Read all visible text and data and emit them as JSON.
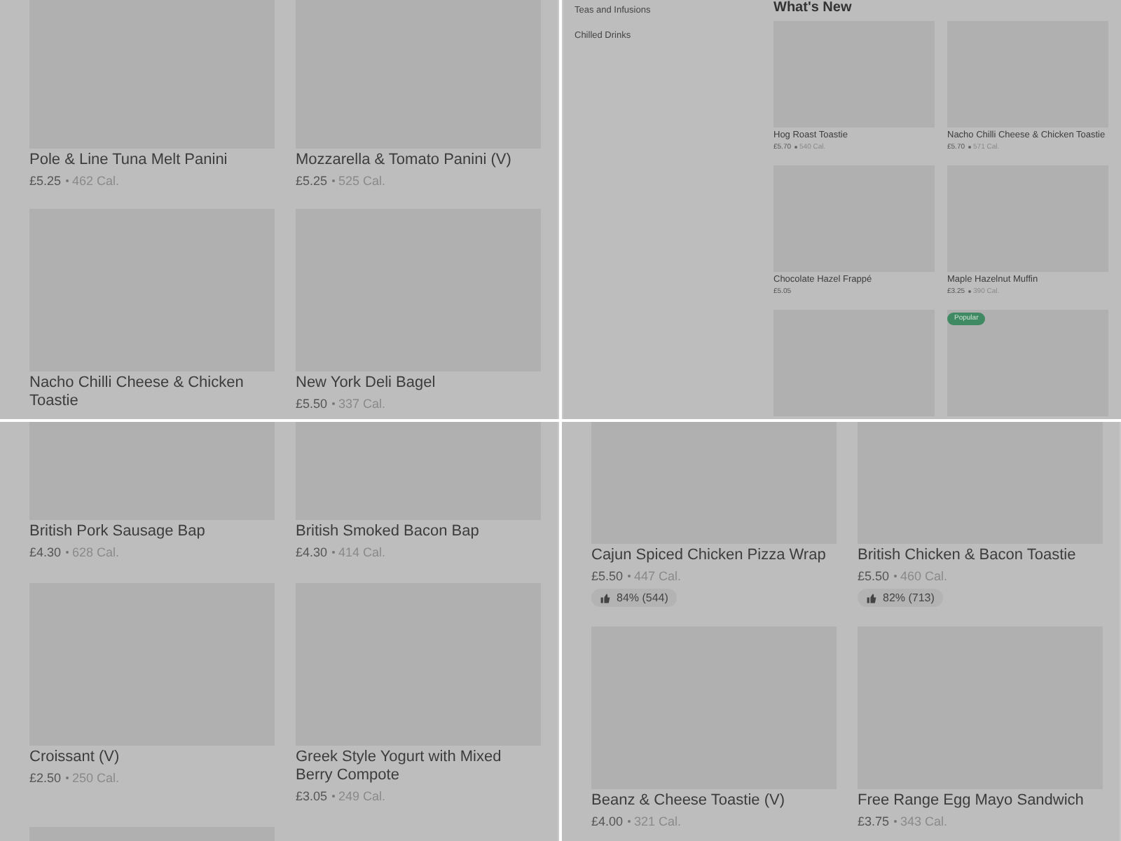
{
  "panels": [
    {
      "kind": "grid",
      "items": [
        {
          "kind": "card",
          "title": "Pole & Line Tuna Melt Panini",
          "price": "£5.25",
          "calories": "462 Cal."
        },
        {
          "kind": "card",
          "title": "Mozzarella & Tomato Panini (V)",
          "price": "£5.25",
          "calories": "525 Cal."
        },
        {
          "kind": "card",
          "title": "Nacho Chilli Cheese & Chicken Toastie"
        },
        {
          "kind": "card",
          "title": "New York Deli Bagel",
          "price": "£5.50",
          "calories": "337 Cal."
        }
      ]
    },
    {
      "kind": "menu",
      "sidebar": {
        "items": [
          {
            "label": "Teas and Infusions"
          },
          {
            "label": "Chilled Drinks"
          }
        ]
      },
      "section_title": "What's New",
      "items": [
        {
          "kind": "card",
          "title": "Hog Roast Toastie",
          "price": "£5.70",
          "calories": "540 Cal."
        },
        {
          "kind": "card",
          "title": "Nacho Chilli Cheese & Chicken Toastie",
          "price": "£5.70",
          "calories": "571 Cal."
        },
        {
          "kind": "card",
          "title": "Chocolate Hazel Frappé",
          "price": "£5.05"
        },
        {
          "kind": "card",
          "title": "Maple Hazelnut Muffin",
          "price": "£3.25",
          "calories": "390 Cal."
        },
        {
          "kind": "image"
        },
        {
          "kind": "image",
          "badge": "Popular"
        }
      ]
    },
    {
      "kind": "grid",
      "items": [
        {
          "kind": "card",
          "title": "British Pork Sausage Bap",
          "price": "£4.30",
          "calories": "628 Cal."
        },
        {
          "kind": "card",
          "title": "British Smoked Bacon Bap",
          "price": "£4.30",
          "calories": "414 Cal."
        },
        {
          "kind": "card",
          "title": "Croissant (V)",
          "price": "£2.50",
          "calories": "250 Cal."
        },
        {
          "kind": "card",
          "title": "Greek Style Yogurt with Mixed Berry Compote",
          "price": "£3.05",
          "calories": "249 Cal."
        },
        {
          "kind": "image"
        }
      ]
    },
    {
      "kind": "grid",
      "items": [
        {
          "kind": "card",
          "title": "Cajun Spiced Chicken Pizza Wrap",
          "price": "£5.50",
          "calories": "447 Cal.",
          "rating": "84% (544)"
        },
        {
          "kind": "card",
          "title": "British Chicken & Bacon Toastie",
          "price": "£5.50",
          "calories": "460 Cal.",
          "rating": "82% (713)"
        },
        {
          "kind": "card",
          "title": "Beanz & Cheese Toastie (V)",
          "price": "£4.00",
          "calories": "321 Cal."
        },
        {
          "kind": "card",
          "title": "Free Range Egg Mayo Sandwich",
          "price": "£3.75",
          "calories": "343 Cal."
        }
      ]
    }
  ]
}
